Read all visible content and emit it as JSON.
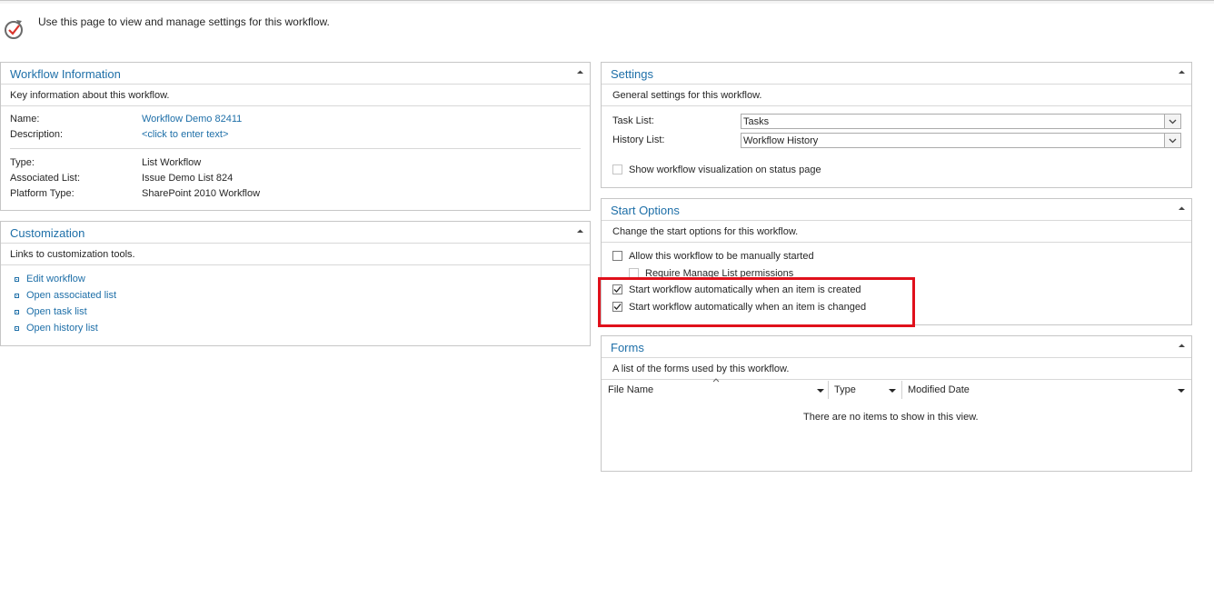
{
  "header": {
    "description": "Use this page to view and manage settings for this workflow."
  },
  "workflow_info": {
    "title": "Workflow Information",
    "subtitle": "Key information about this workflow.",
    "rows": [
      {
        "label": "Name:",
        "value": "Workflow Demo 82411"
      },
      {
        "label": "Description:",
        "value": "<click to enter text>"
      },
      {
        "label": "Type:",
        "value": "List Workflow"
      },
      {
        "label": "Associated List:",
        "value": "Issue Demo List 824"
      },
      {
        "label": "Platform Type:",
        "value": "SharePoint 2010 Workflow"
      }
    ]
  },
  "customization": {
    "title": "Customization",
    "subtitle": "Links to customization tools.",
    "links": [
      "Edit workflow",
      "Open associated list",
      "Open task list",
      "Open history list"
    ]
  },
  "settings": {
    "title": "Settings",
    "subtitle": "General settings for this workflow.",
    "task_list_label": "Task List:",
    "task_list_value": "Tasks",
    "history_list_label": "History List:",
    "history_list_value": "Workflow History",
    "visualization_label": "Show workflow visualization on status page",
    "visualization_checked": false
  },
  "start_options": {
    "title": "Start Options",
    "subtitle": "Change the start options for this workflow.",
    "options": [
      {
        "label": "Allow this workflow to be manually started",
        "checked": false
      },
      {
        "label": "Require Manage List permissions",
        "checked": false
      },
      {
        "label": "Start workflow automatically when an item is created",
        "checked": true
      },
      {
        "label": "Start workflow automatically when an item is changed",
        "checked": true
      }
    ]
  },
  "forms": {
    "title": "Forms",
    "subtitle": "A list of the forms used by this workflow.",
    "columns": [
      "File Name",
      "Type",
      "Modified Date"
    ],
    "empty_message": "There are no items to show in this view."
  },
  "colors": {
    "accent": "#1e6fa8",
    "highlight": "#e0101b"
  }
}
